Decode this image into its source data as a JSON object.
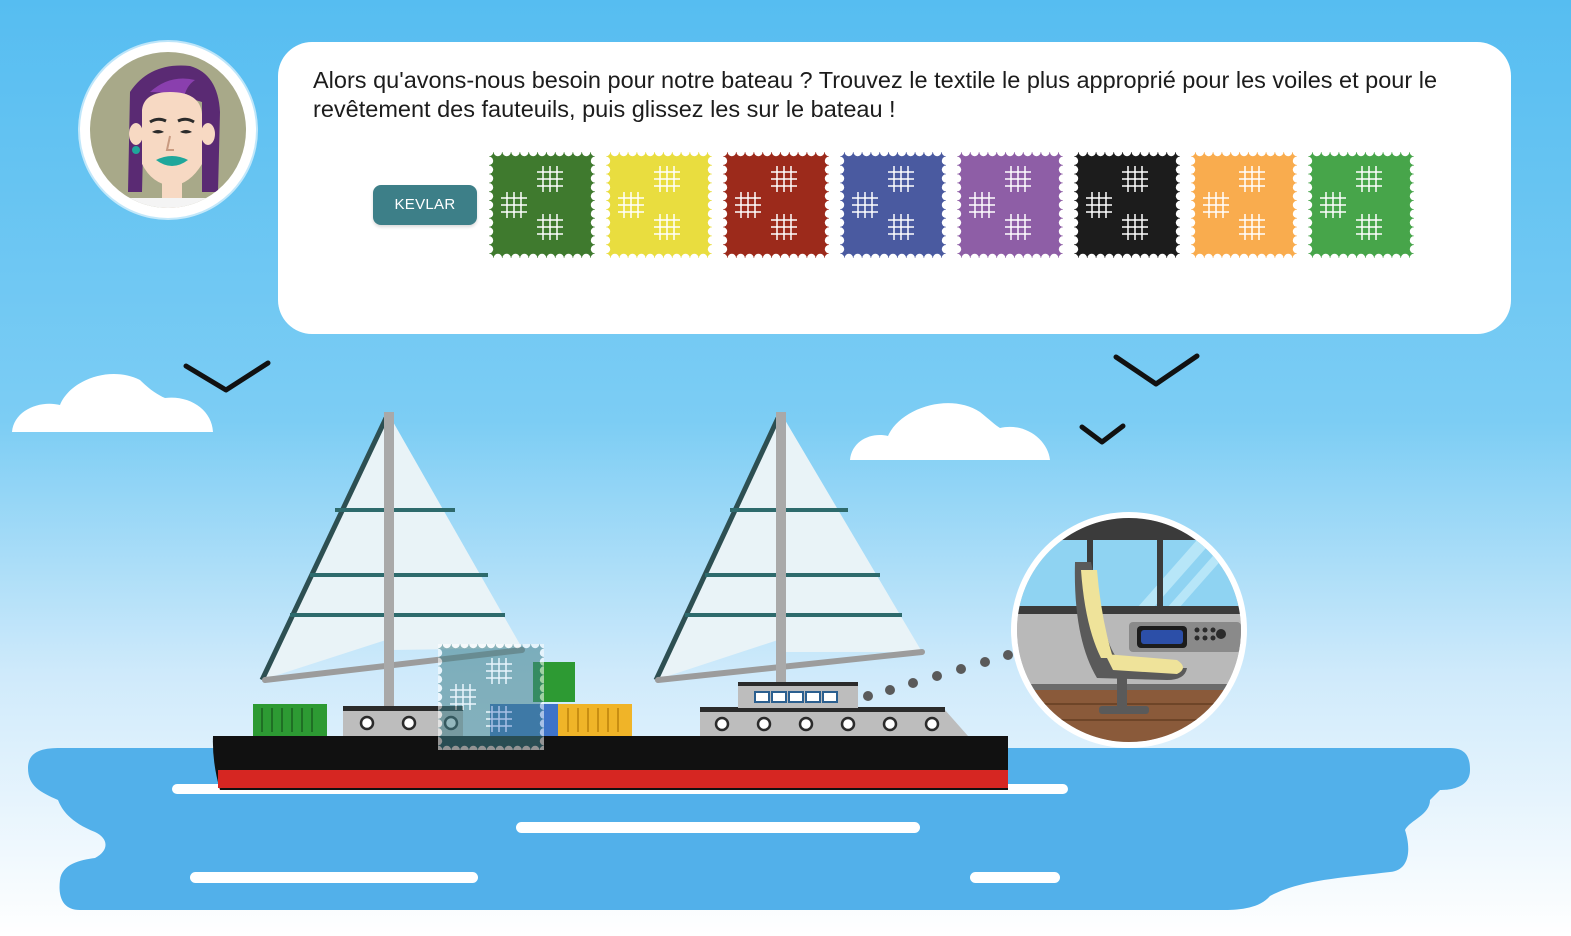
{
  "instruction": "Alors qu'avons-nous besoin pour notre bateau ? Trouvez le textile le plus approprié pour les voiles et pour le revêtement des fauteuils, puis glissez les sur le bateau !",
  "selected_textile_label": "KEVLAR",
  "avatar_icon": "woman-purple-hair-avatar-icon",
  "swatches": [
    {
      "name": "dark-green-textile",
      "color": "#3f7a2e"
    },
    {
      "name": "yellow-textile",
      "color": "#e9dd3f"
    },
    {
      "name": "red-textile",
      "color": "#9c2a1b"
    },
    {
      "name": "blue-textile",
      "color": "#4a5aa0"
    },
    {
      "name": "purple-textile",
      "color": "#8e5ea6"
    },
    {
      "name": "black-textile",
      "color": "#1c1c1c"
    },
    {
      "name": "orange-textile",
      "color": "#f9ac4e"
    },
    {
      "name": "green-textile",
      "color": "#47a54a"
    }
  ],
  "dragged_swatch_color": "#3e7f8a",
  "colors": {
    "sky": "#56bdf1",
    "sea": "#52b0ea",
    "hull_black": "#111111",
    "hull_red": "#d62622",
    "kevlar_button": "#3d7f88"
  }
}
